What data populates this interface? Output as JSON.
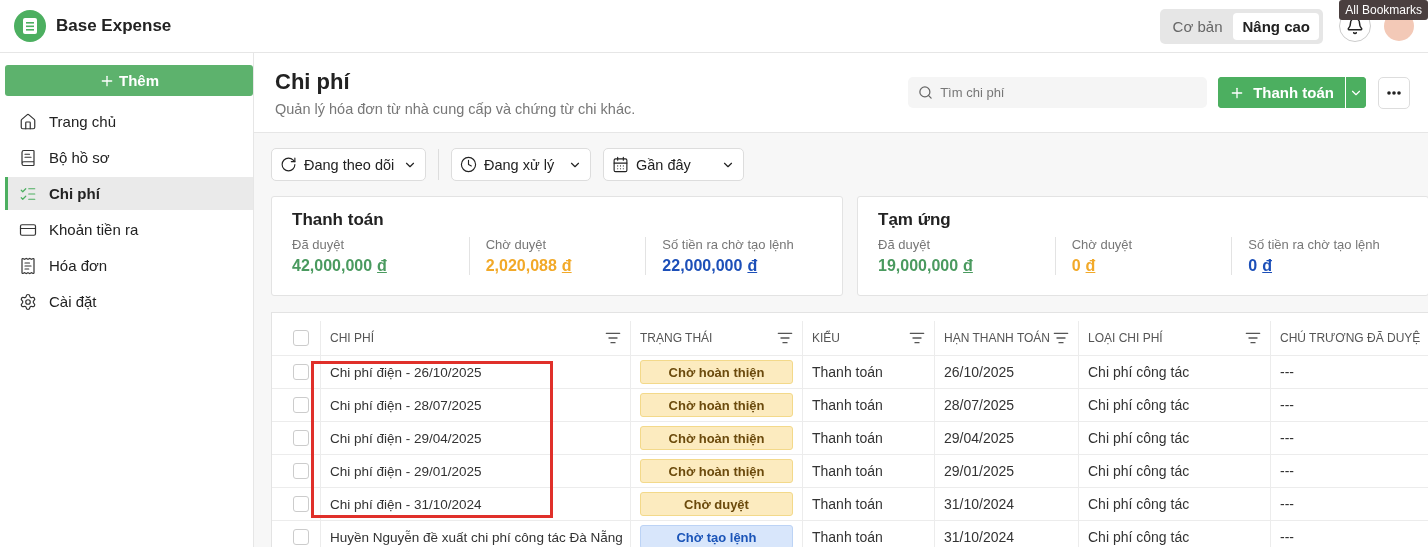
{
  "app": {
    "name": "Base Expense"
  },
  "mode_switch": [
    {
      "label": "Cơ bản",
      "selected": false
    },
    {
      "label": "Nâng cao",
      "selected": true
    }
  ],
  "tooltip": "All Bookmarks",
  "sidebar": {
    "add_button": "Thêm",
    "items": [
      {
        "label": "Trang chủ",
        "selected": false
      },
      {
        "label": "Bộ hồ sơ",
        "selected": false
      },
      {
        "label": "Chi phí",
        "selected": true
      },
      {
        "label": "Khoản tiền ra",
        "selected": false
      },
      {
        "label": "Hóa đơn",
        "selected": false
      },
      {
        "label": "Cài đặt",
        "selected": false
      }
    ]
  },
  "page": {
    "title": "Chi phí",
    "subtitle": "Quản lý hóa đơn từ nhà cung cấp và chứng từ chi khác.",
    "search_placeholder": "Tìm chi phí",
    "primary_button": "Thanh toán"
  },
  "filters": [
    {
      "label": "Đang theo dõi"
    },
    {
      "label": "Đang xử lý"
    },
    {
      "label": "Gần đây"
    }
  ],
  "summaries": [
    {
      "title": "Thanh toán",
      "stats": [
        {
          "label": "Đã duyệt",
          "amount": "42,000,000",
          "currency": "đ",
          "color": "#4a9a5f"
        },
        {
          "label": "Chờ duyệt",
          "amount": "2,020,088",
          "currency": "đ",
          "color": "#f2a928"
        },
        {
          "label": "Số tiền ra chờ tạo lệnh",
          "amount": "22,000,000",
          "currency": "đ",
          "color": "#1c4fb8"
        }
      ]
    },
    {
      "title": "Tạm ứng",
      "stats": [
        {
          "label": "Đã duyệt",
          "amount": "19,000,000",
          "currency": "đ",
          "color": "#4a9a5f"
        },
        {
          "label": "Chờ duyệt",
          "amount": "0",
          "currency": "đ",
          "color": "#f2a928"
        },
        {
          "label": "Số tiền ra chờ tạo lệnh",
          "amount": "0",
          "currency": "đ",
          "color": "#1c4fb8"
        }
      ]
    }
  ],
  "table": {
    "select_all_checked": false,
    "columns": [
      {
        "label": "CHI PHÍ",
        "filter": true
      },
      {
        "label": "TRẠNG THÁI",
        "filter": true
      },
      {
        "label": "KIỂU",
        "filter": true
      },
      {
        "label": "HẠN THANH TOÁN",
        "filter": true
      },
      {
        "label": "LOẠI CHI PHÍ",
        "filter": true
      },
      {
        "label": "CHÚ TRƯƠNG ĐÃ DUYỆ",
        "filter": false
      }
    ],
    "rows": [
      {
        "checked": false,
        "highlighted": true,
        "name": "Chi phí điện - 26/10/2025",
        "status": {
          "label": "Chờ hoàn thiện",
          "kind": "pending"
        },
        "type": "Thanh toán",
        "due": "26/10/2025",
        "category": "Chi phí công tác",
        "approval": "---"
      },
      {
        "checked": false,
        "highlighted": true,
        "name": "Chi phí điện - 28/07/2025",
        "status": {
          "label": "Chờ hoàn thiện",
          "kind": "pending"
        },
        "type": "Thanh toán",
        "due": "28/07/2025",
        "category": "Chi phí công tác",
        "approval": "---"
      },
      {
        "checked": false,
        "highlighted": true,
        "name": "Chi phí điện - 29/04/2025",
        "status": {
          "label": "Chờ hoàn thiện",
          "kind": "pending"
        },
        "type": "Thanh toán",
        "due": "29/04/2025",
        "category": "Chi phí công tác",
        "approval": "---"
      },
      {
        "checked": false,
        "highlighted": true,
        "name": "Chi phí điện - 29/01/2025",
        "status": {
          "label": "Chờ hoàn thiện",
          "kind": "pending"
        },
        "type": "Thanh toán",
        "due": "29/01/2025",
        "category": "Chi phí công tác",
        "approval": "---"
      },
      {
        "checked": false,
        "highlighted": true,
        "name": "Chi phí điện - 31/10/2024",
        "status": {
          "label": "Chờ duyệt",
          "kind": "pending"
        },
        "type": "Thanh toán",
        "due": "31/10/2024",
        "category": "Chi phí công tác",
        "approval": "---"
      },
      {
        "checked": false,
        "highlighted": false,
        "name": "Huyền Nguyễn đề xuất chi phí công tác Đà Nẵng",
        "status": {
          "label": "Chờ tạo lệnh",
          "kind": "awaiting"
        },
        "type": "Thanh toán",
        "due": "31/10/2024",
        "category": "Chi phí công tác",
        "approval": "---"
      }
    ]
  }
}
